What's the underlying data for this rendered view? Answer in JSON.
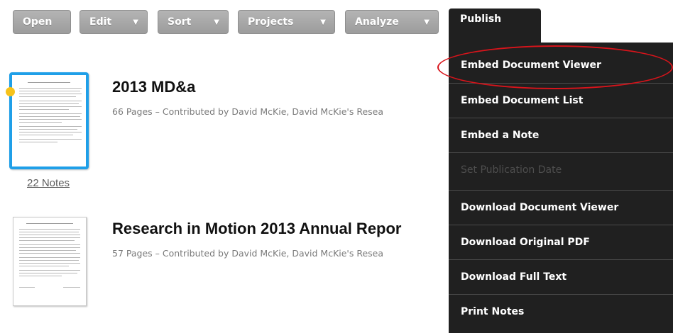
{
  "toolbar": {
    "open": "Open",
    "edit": "Edit",
    "sort": "Sort",
    "projects": "Projects",
    "analyze": "Analyze",
    "publish": "Publish",
    "caret": "▼"
  },
  "documents": [
    {
      "title": "2013 MD&a",
      "meta": "66 Pages – Contributed by David McKie, David McKie's Resea",
      "notes": "22 Notes"
    },
    {
      "title": "Research in Motion 2013 Annual Repor",
      "meta": "57 Pages – Contributed by David McKie, David McKie's Resea"
    }
  ],
  "publish_menu": {
    "items": [
      {
        "label": "Embed Document Viewer",
        "disabled": false
      },
      {
        "label": "Embed Document List",
        "disabled": false
      },
      {
        "label": "Embed a Note",
        "disabled": false
      },
      {
        "label": "Set Publication Date",
        "disabled": true
      },
      {
        "label": "Download Document Viewer",
        "disabled": false
      },
      {
        "label": "Download Original PDF",
        "disabled": false
      },
      {
        "label": "Download Full Text",
        "disabled": false
      },
      {
        "label": "Print Notes",
        "disabled": false
      }
    ]
  },
  "colors": {
    "toolbar_button": "#a8a8a8",
    "menu_background": "#202020",
    "selected_border": "#1f9fe8",
    "highlight_ellipse": "#d8141b",
    "note_pin": "#f6c21a"
  }
}
